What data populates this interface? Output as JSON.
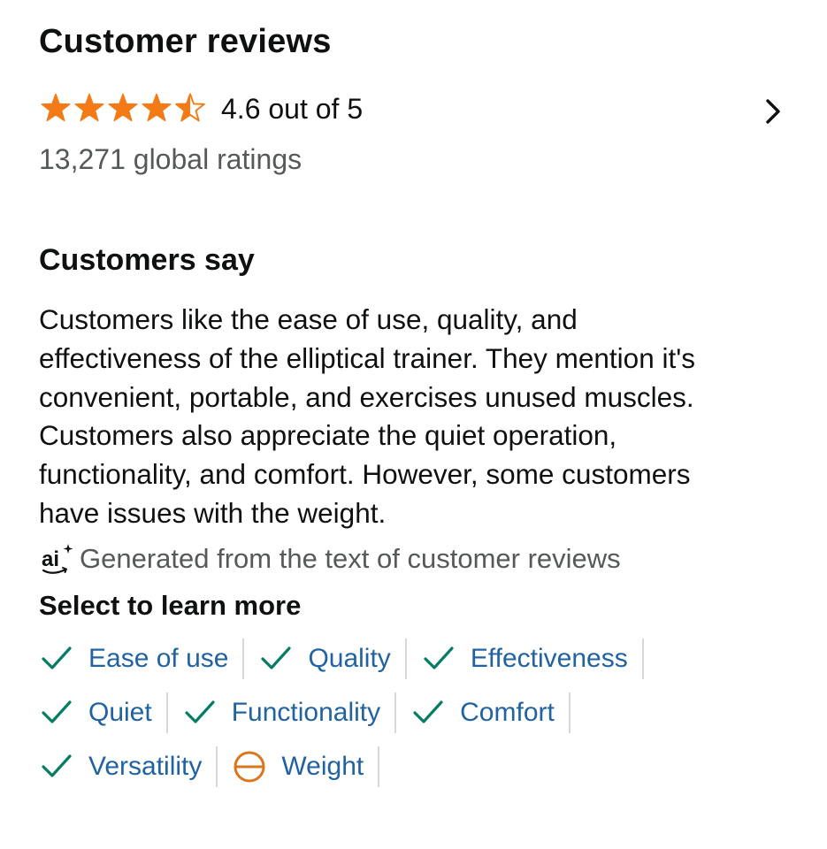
{
  "header": {
    "title": "Customer reviews",
    "rating_value": 4.6,
    "rating_text": "4.6 out of 5",
    "global_ratings": "13,271 global ratings"
  },
  "stars": {
    "filled": 4,
    "half": 1,
    "empty": 0,
    "color": "#f47a17"
  },
  "customers_say": {
    "heading": "Customers say",
    "summary_lines": [
      "Customers like the ease of use, quality, and",
      "effectiveness of the elliptical trainer. They mention it's",
      "convenient, portable, and exercises unused muscles.",
      "Customers also appreciate the quiet operation,",
      "functionality, and comfort. However, some customers",
      "have issues with the weight."
    ],
    "ai_badge": "ai",
    "ai_note": "Generated from the text of customer reviews"
  },
  "learn_more": {
    "heading": "Select to learn more",
    "rows": [
      [
        {
          "label": "Ease of use",
          "sentiment": "positive",
          "icon": "check-icon"
        },
        {
          "label": "Quality",
          "sentiment": "positive",
          "icon": "check-icon"
        },
        {
          "label": "Effectiveness",
          "sentiment": "positive",
          "icon": "check-icon"
        }
      ],
      [
        {
          "label": "Quiet",
          "sentiment": "positive",
          "icon": "check-icon"
        },
        {
          "label": "Functionality",
          "sentiment": "positive",
          "icon": "check-icon"
        },
        {
          "label": "Comfort",
          "sentiment": "positive",
          "icon": "check-icon"
        }
      ],
      [
        {
          "label": "Versatility",
          "sentiment": "positive",
          "icon": "check-icon"
        },
        {
          "label": "Weight",
          "sentiment": "mixed",
          "icon": "minus-circle-icon"
        }
      ]
    ]
  },
  "colors": {
    "positive": "#067d62",
    "mixed": "#d9771e",
    "link": "#2162a1",
    "muted": "#565959",
    "star": "#f47a17"
  },
  "icons": {
    "chevron": "chevron-right-icon",
    "ai": "ai-sparkle-icon"
  }
}
